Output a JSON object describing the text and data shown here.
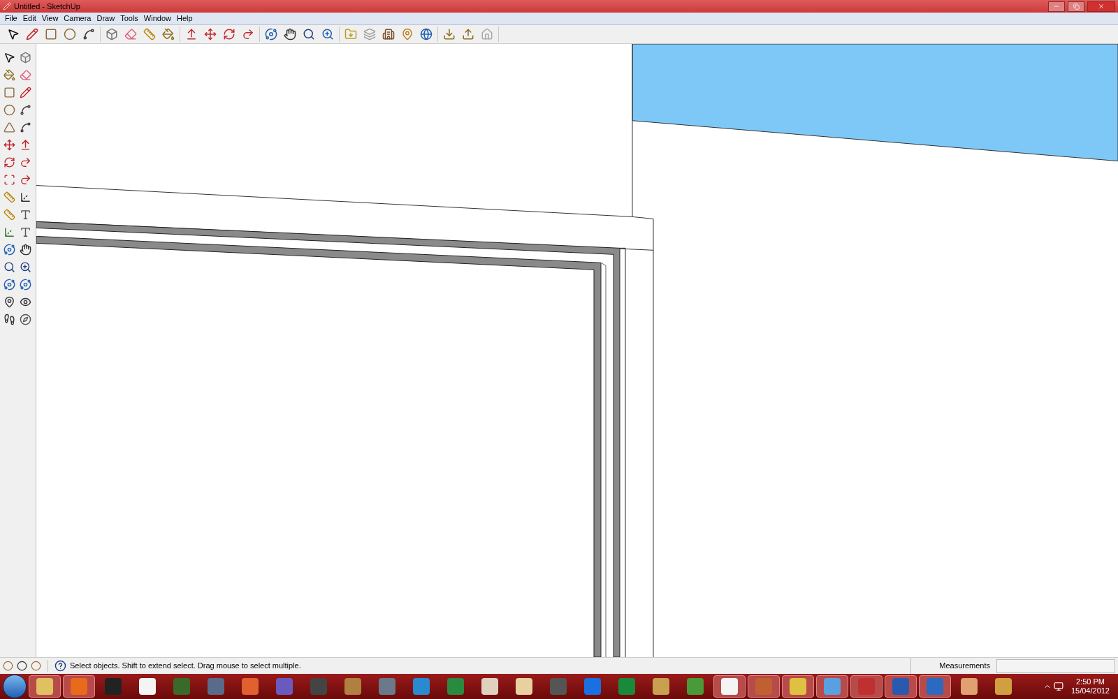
{
  "window": {
    "title": "Untitled - SketchUp"
  },
  "menu": [
    {
      "label": "File"
    },
    {
      "label": "Edit"
    },
    {
      "label": "View"
    },
    {
      "label": "Camera"
    },
    {
      "label": "Draw"
    },
    {
      "label": "Tools"
    },
    {
      "label": "Window"
    },
    {
      "label": "Help"
    }
  ],
  "status_bar": {
    "hint": "Select objects. Shift to extend select. Drag mouse to select multiple.",
    "measurements_label": "Measurements"
  },
  "taskbar": {
    "time": "2:50 PM",
    "date": "15/04/2012"
  }
}
